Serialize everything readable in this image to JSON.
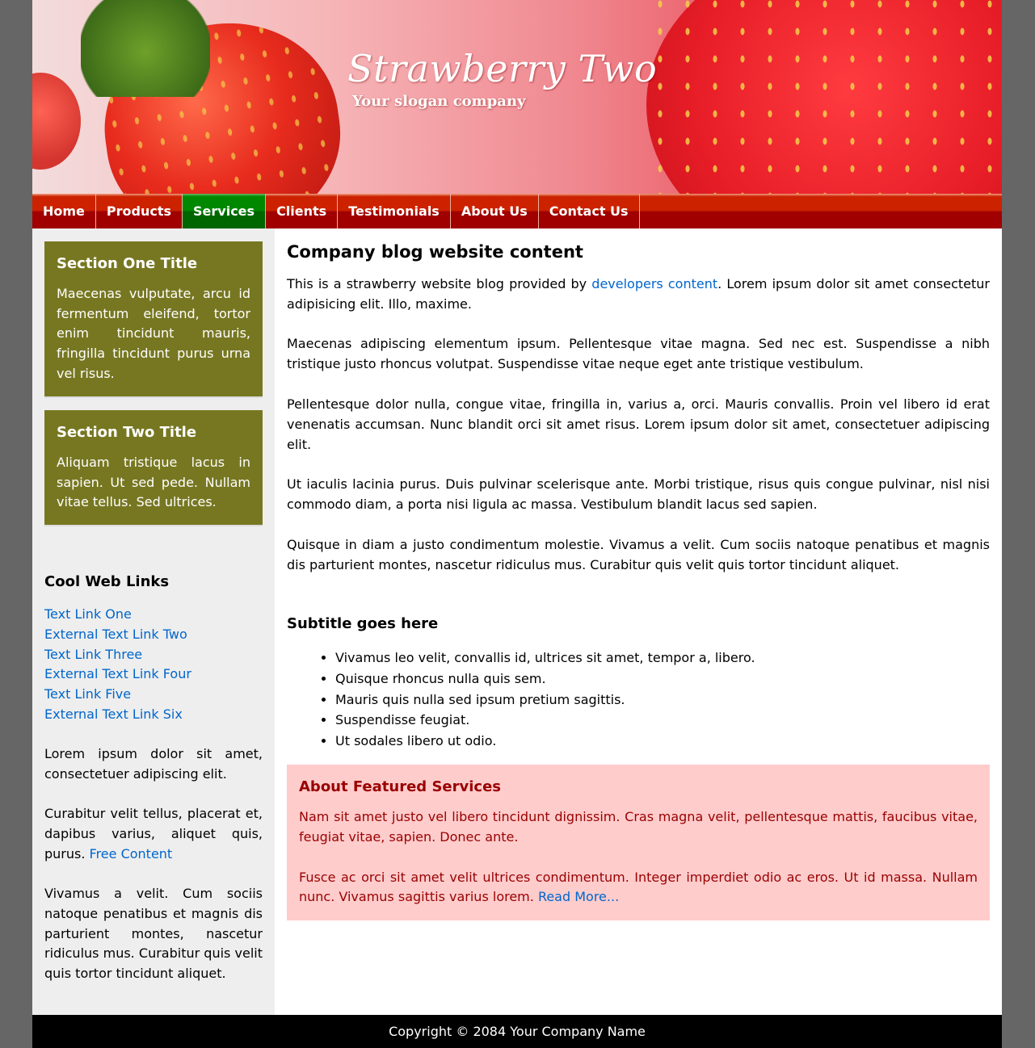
{
  "header": {
    "title": "Strawberry Two",
    "slogan": "Your slogan company"
  },
  "nav": {
    "items": [
      {
        "label": "Home",
        "active": false
      },
      {
        "label": "Products",
        "active": false
      },
      {
        "label": "Services",
        "active": true
      },
      {
        "label": "Clients",
        "active": false
      },
      {
        "label": "Testimonials",
        "active": false
      },
      {
        "label": "About Us",
        "active": false
      },
      {
        "label": "Contact Us",
        "active": false
      }
    ]
  },
  "sidebar": {
    "section_one": {
      "title": "Section One Title",
      "text": "Maecenas vulputate, arcu id fermentum eleifend, tortor enim tincidunt mauris, fringilla tincidunt purus urna vel risus."
    },
    "section_two": {
      "title": "Section Two Title",
      "text": "Aliquam tristique lacus in sapien. Ut sed pede. Nullam vitae tellus. Sed ultrices."
    },
    "links_title": "Cool Web Links",
    "links": [
      "Text Link One",
      "External Text Link Two",
      "Text Link Three",
      "External Text Link Four",
      "Text Link Five",
      "External Text Link Six"
    ],
    "para1": "Lorem ipsum dolor sit amet, consectetuer adipiscing elit.",
    "para2": "Curabitur velit tellus, placerat et, dapibus varius, aliquet quis, purus.",
    "para2_link": "Free Content",
    "para3": "Vivamus a velit. Cum sociis natoque penatibus et magnis dis parturient montes, nascetur ridiculus mus. Curabitur quis velit quis tortor tincidunt aliquet."
  },
  "main": {
    "title": "Company blog website content",
    "intro_before": "This is a strawberry website blog provided by ",
    "intro_link": "developers content",
    "intro_after": ". Lorem ipsum dolor sit amet consectetur adipisicing elit. Illo, maxime.",
    "paragraphs": [
      "Maecenas adipiscing elementum ipsum. Pellentesque vitae magna. Sed nec est. Suspendisse a nibh tristique justo rhoncus volutpat. Suspendisse vitae neque eget ante tristique vestibulum.",
      "Pellentesque dolor nulla, congue vitae, fringilla in, varius a, orci. Mauris convallis. Proin vel libero id erat venenatis accumsan. Nunc blandit orci sit amet risus. Lorem ipsum dolor sit amet, consectetuer adipiscing elit.",
      "Ut iaculis lacinia purus. Duis pulvinar scelerisque ante. Morbi tristique, risus quis congue pulvinar, nisl nisi commodo diam, a porta nisi ligula ac massa. Vestibulum blandit lacus sed sapien.",
      "Quisque in diam a justo condimentum molestie. Vivamus a velit. Cum sociis natoque penatibus et magnis dis parturient montes, nascetur ridiculus mus. Curabitur quis velit quis tortor tincidunt aliquet."
    ],
    "subtitle": "Subtitle goes here",
    "bullets": [
      "Vivamus leo velit, convallis id, ultrices sit amet, tempor a, libero.",
      "Quisque rhoncus nulla quis sem.",
      "Mauris quis nulla sed ipsum pretium sagittis.",
      "Suspendisse feugiat.",
      "Ut sodales libero ut odio."
    ],
    "featured": {
      "title": "About Featured Services",
      "para1": "Nam sit amet justo vel libero tincidunt dignissim. Cras magna velit, pellentesque mattis, faucibus vitae, feugiat vitae, sapien. Donec ante.",
      "para2": "Fusce ac orci sit amet velit ultrices condimentum. Integer imperdiet odio ac eros. Ut id massa. Nullam nunc. Vivamus sagittis varius lorem. ",
      "read_more": "Read More..."
    }
  },
  "footer": {
    "text": "Copyright © 2084 Your Company Name"
  },
  "colors": {
    "page_background": "#666666",
    "nav_red": "#cc2200",
    "nav_active_green": "#008800",
    "section_box": "#777722",
    "featured_bg": "#ffcccc",
    "featured_text": "#990000",
    "link": "#0066cc",
    "footer": "#000000"
  }
}
